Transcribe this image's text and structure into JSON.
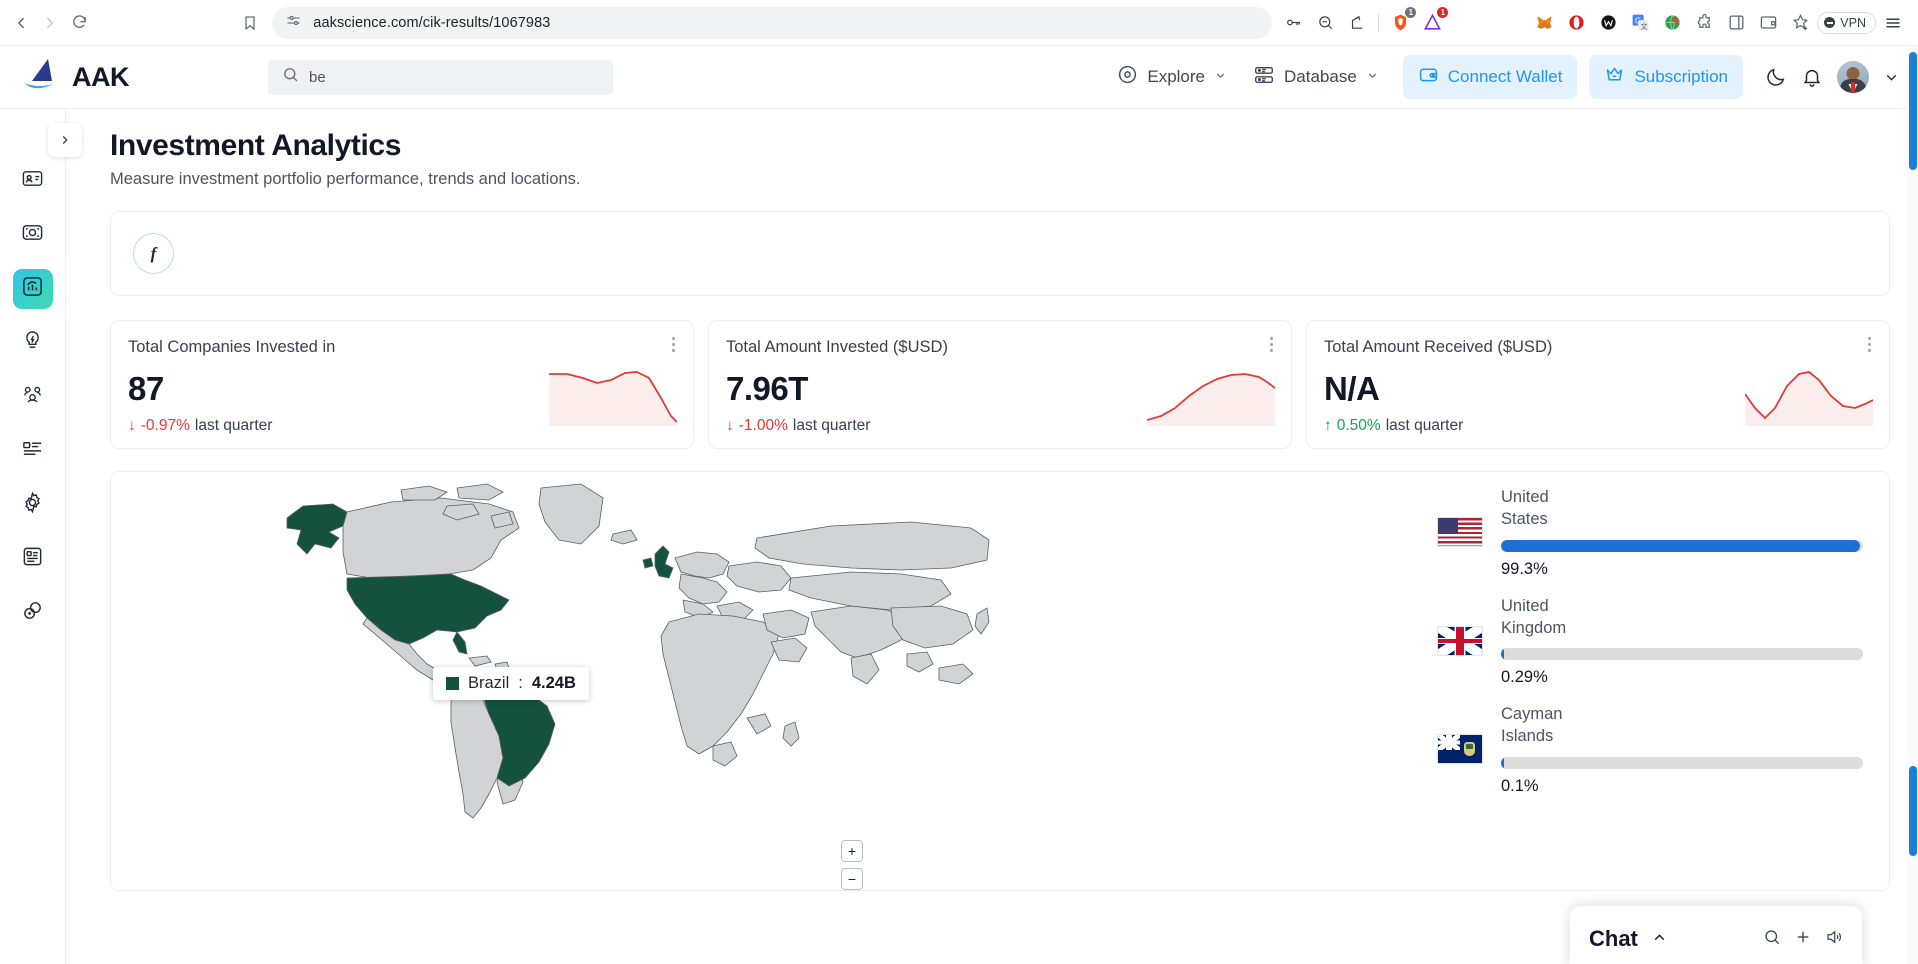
{
  "browser": {
    "url": "aakscience.com/cik-results/1067983",
    "back_icon": "back-arrow-icon",
    "forward_icon": "forward-arrow-icon",
    "reload_icon": "reload-icon",
    "bookmark_icon": "bookmark-icon",
    "site_settings_icon": "site-settings-icon",
    "extensions": [
      {
        "name": "password-key-icon",
        "glyph": "⚿",
        "badge": ""
      },
      {
        "name": "zoom-out-icon",
        "glyph": "⊖",
        "badge": ""
      },
      {
        "name": "share-icon",
        "glyph": "⤴",
        "badge": ""
      },
      {
        "name": "brave-shield-icon",
        "glyph": "◆",
        "badge": "1"
      },
      {
        "name": "triangle-alert-icon",
        "glyph": "△",
        "badge": "1"
      },
      {
        "name": "metamask-fox-icon",
        "glyph": "◈",
        "badge": ""
      },
      {
        "name": "opera-icon",
        "glyph": "⭕",
        "badge": ""
      },
      {
        "name": "wallet-dark-icon",
        "glyph": "Ⓜ",
        "badge": ""
      },
      {
        "name": "google-translate-icon",
        "glyph": "G",
        "badge": ""
      },
      {
        "name": "globe-download-icon",
        "glyph": "ἰd",
        "badge": ""
      },
      {
        "name": "puzzle-extension-icon",
        "glyph": "⬠",
        "badge": ""
      },
      {
        "name": "sidebar-panel-icon",
        "glyph": "⎕",
        "badge": ""
      },
      {
        "name": "wallet-card-icon",
        "glyph": "⌸",
        "badge": ""
      },
      {
        "name": "add-star-icon",
        "glyph": "☆",
        "badge": ""
      }
    ],
    "vpn_label": "VPN",
    "menu_icon": "hamburger-menu-icon"
  },
  "header": {
    "brand": "AAK",
    "logo_icon": "sailboat-wave-logo",
    "search": {
      "value": "be",
      "icon": "search-icon"
    },
    "nav": [
      {
        "label": "Explore",
        "icon": "explore-compass-icon"
      },
      {
        "label": "Database",
        "icon": "database-server-icon"
      }
    ],
    "connect_wallet": {
      "label": "Connect Wallet",
      "icon": "wallet-icon"
    },
    "subscription": {
      "label": "Subscription",
      "icon": "crown-icon"
    },
    "icons": [
      "moon-dark-mode-icon",
      "bell-notification-icon",
      "user-avatar",
      "chevron-down-icon"
    ]
  },
  "sidebar": {
    "expand_icon": "chevron-right-icon",
    "items": [
      {
        "name": "sidebar-item-profile",
        "icon": "contact-card-icon",
        "active": false
      },
      {
        "name": "sidebar-item-capture",
        "icon": "camera-focus-icon",
        "active": false
      },
      {
        "name": "sidebar-item-analytics",
        "icon": "analytics-chart-icon",
        "active": true
      },
      {
        "name": "sidebar-item-insights",
        "icon": "lightbulb-icon",
        "active": false
      },
      {
        "name": "sidebar-item-community",
        "icon": "users-group-icon",
        "active": false
      },
      {
        "name": "sidebar-item-list",
        "icon": "list-view-icon",
        "active": false
      },
      {
        "name": "sidebar-item-settings",
        "icon": "gear-icon",
        "active": false
      },
      {
        "name": "sidebar-item-documents",
        "icon": "document-text-icon",
        "active": false
      },
      {
        "name": "sidebar-item-links",
        "icon": "link-chain-icon",
        "active": false
      }
    ]
  },
  "page": {
    "title": "Investment Analytics",
    "subtitle": "Measure investment portfolio performance, trends and locations.",
    "social": {
      "icon": "facebook-icon",
      "glyph": "f"
    }
  },
  "stats": [
    {
      "title": "Total Companies Invested in",
      "value": "87",
      "delta": "-0.97%",
      "delta_dir": "down",
      "delta_arrow": "↓",
      "delta_label": "last quarter",
      "color": "#e53935",
      "spark": [
        30,
        30,
        31,
        33,
        36,
        38,
        36,
        30,
        26,
        26,
        30,
        52,
        62
      ]
    },
    {
      "title": "Total Amount Invested ($USD)",
      "value": "7.96T",
      "delta": "-1.00%",
      "delta_dir": "down",
      "delta_arrow": "↓",
      "delta_label": "last quarter",
      "color": "#e53935",
      "spark": [
        58,
        54,
        46,
        36,
        28,
        22,
        18,
        16,
        16,
        18,
        22,
        28,
        34
      ]
    },
    {
      "title": "Total Amount Received ($USD)",
      "value": "N/A",
      "delta": "0.50%",
      "delta_dir": "up",
      "delta_arrow": "↑",
      "delta_label": "last quarter",
      "color": "#15a05a",
      "spark": [
        40,
        18,
        8,
        20,
        42,
        56,
        58,
        48,
        34,
        24,
        22,
        26,
        30
      ]
    }
  ],
  "map": {
    "tooltip": {
      "country": "Brazil",
      "value": "4.24B",
      "swatch_color": "#14523e"
    },
    "highlight_color": "#14523e",
    "base_color": "#d2d3d4",
    "zoom_in": "+",
    "zoom_out": "−"
  },
  "countries": [
    {
      "name": "United States",
      "flag": "us-flag",
      "percent": "99.3%",
      "pct_value": 99.3
    },
    {
      "name": "United Kingdom",
      "flag": "uk-flag",
      "percent": "0.29%",
      "pct_value": 0.29
    },
    {
      "name": "Cayman Islands",
      "flag": "cayman-islands-flag",
      "percent": "0.1%",
      "pct_value": 0.1
    }
  ],
  "chat": {
    "title": "Chat",
    "caret": "⌃",
    "actions": [
      "search-icon",
      "add-icon",
      "speaker-icon"
    ]
  }
}
